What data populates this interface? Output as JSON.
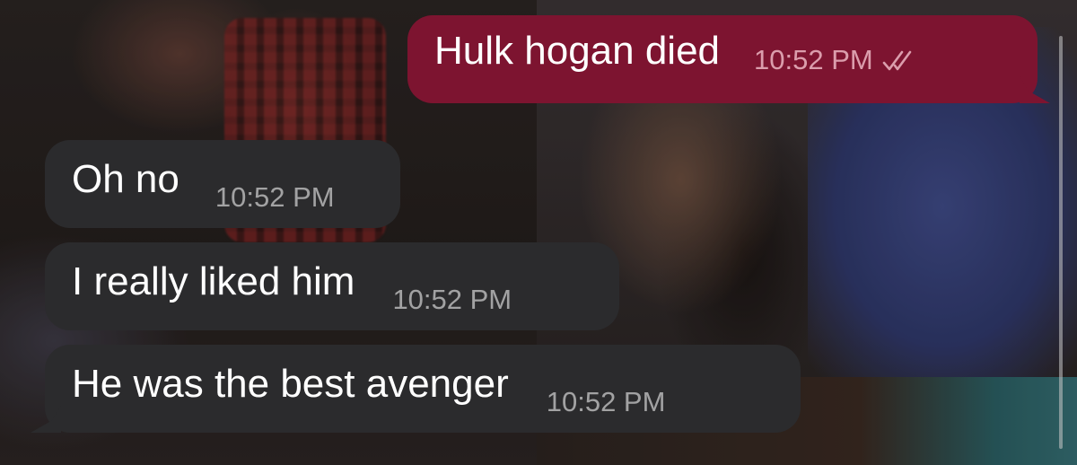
{
  "messages": [
    {
      "direction": "outgoing",
      "text": "Hulk hogan died",
      "time": "10:52 PM",
      "status_icon": "double-check-icon"
    },
    {
      "direction": "incoming",
      "text": "Oh no",
      "time": "10:52 PM"
    },
    {
      "direction": "incoming",
      "text": "I really liked him",
      "time": "10:52 PM"
    },
    {
      "direction": "incoming",
      "text": "He was the best avenger",
      "time": "10:52 PM"
    }
  ],
  "colors": {
    "outgoing_bubble": "#7d1430",
    "incoming_bubble": "#2b2b2d",
    "message_text": "#ffffff"
  }
}
